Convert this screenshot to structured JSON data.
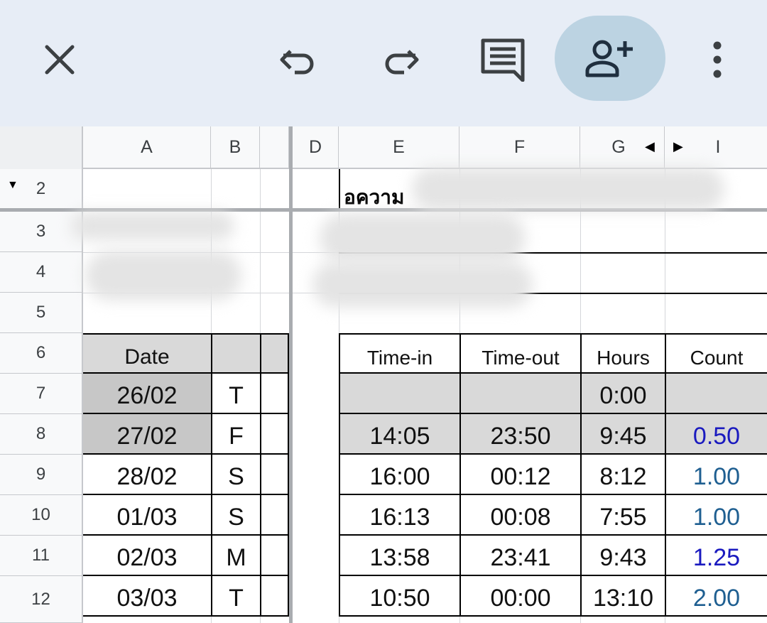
{
  "toolbar": {
    "close_icon": "close-icon",
    "undo_icon": "undo-icon",
    "redo_icon": "redo-icon",
    "comment_icon": "comment-icon",
    "share_icon": "add-person-icon",
    "more_icon": "more-vert-icon",
    "share_bg": "#bcd3e2",
    "bg": "#e7edf6"
  },
  "sheet": {
    "columns": [
      "A",
      "B",
      "",
      "D",
      "E",
      "F",
      "G",
      "I"
    ],
    "rows": [
      "2",
      "3",
      "4",
      "5",
      "6",
      "7",
      "8",
      "9",
      "10",
      "11",
      "12"
    ],
    "title_partial": "อความ",
    "header": {
      "date": "Date",
      "time_in": "Time-in",
      "time_out": "Time-out",
      "hours": "Hours",
      "count": "Count"
    },
    "data": [
      {
        "date": "26/02",
        "day": "T",
        "time_in": "",
        "time_out": "",
        "hours": "0:00",
        "count": ""
      },
      {
        "date": "27/02",
        "day": "F",
        "time_in": "14:05",
        "time_out": "23:50",
        "hours": "9:45",
        "count": "0.50"
      },
      {
        "date": "28/02",
        "day": "S",
        "time_in": "16:00",
        "time_out": "00:12",
        "hours": "8:12",
        "count": "1.00"
      },
      {
        "date": "01/03",
        "day": "S",
        "time_in": "16:13",
        "time_out": "00:08",
        "hours": "7:55",
        "count": "1.00"
      },
      {
        "date": "02/03",
        "day": "M",
        "time_in": "13:58",
        "time_out": "23:41",
        "hours": "9:43",
        "count": "1.25"
      },
      {
        "date": "03/03",
        "day": "T",
        "time_in": "10:50",
        "time_out": "00:00",
        "hours": "13:10",
        "count": "2.00"
      }
    ],
    "colors": {
      "count_dark_blue": "#1a1abf",
      "count_mid_blue": "#1f5f91",
      "gray_cell": "#d9d9d9"
    }
  }
}
